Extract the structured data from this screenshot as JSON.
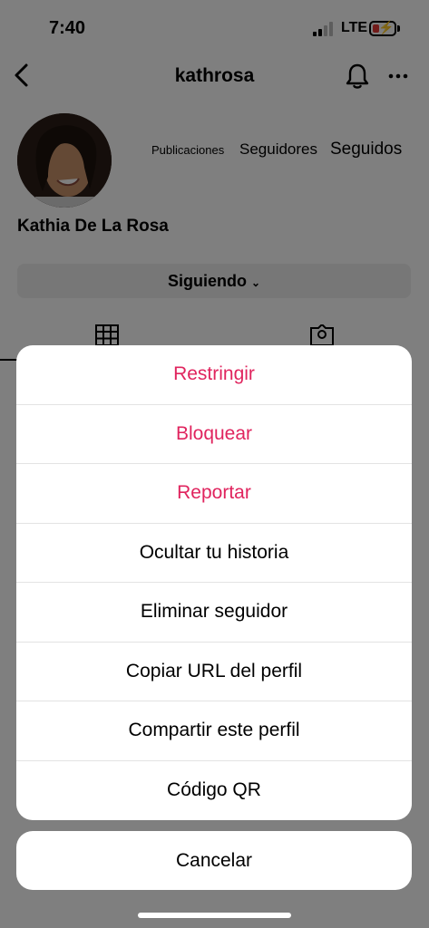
{
  "status_bar": {
    "time": "7:40",
    "network": "LTE"
  },
  "nav": {
    "title": "kathrosa"
  },
  "profile": {
    "name": "Kathia De La Rosa",
    "stats": {
      "posts_label": "Publicaciones",
      "followers_label": "Seguidores",
      "following_label": "Seguidos"
    },
    "following_button": "Siguiendo"
  },
  "action_sheet": {
    "items": [
      {
        "label": "Restringir",
        "style": "danger"
      },
      {
        "label": "Bloquear",
        "style": "danger"
      },
      {
        "label": "Reportar",
        "style": "danger"
      },
      {
        "label": "Ocultar tu historia",
        "style": "normal"
      },
      {
        "label": "Eliminar seguidor",
        "style": "normal"
      },
      {
        "label": "Copiar URL del perfil",
        "style": "normal"
      },
      {
        "label": "Compartir este perfil",
        "style": "normal"
      },
      {
        "label": "Código QR",
        "style": "normal"
      }
    ],
    "cancel": "Cancelar"
  },
  "colors": {
    "danger": "#e0245e",
    "overlay": "rgba(0,0,0,0.5)"
  }
}
